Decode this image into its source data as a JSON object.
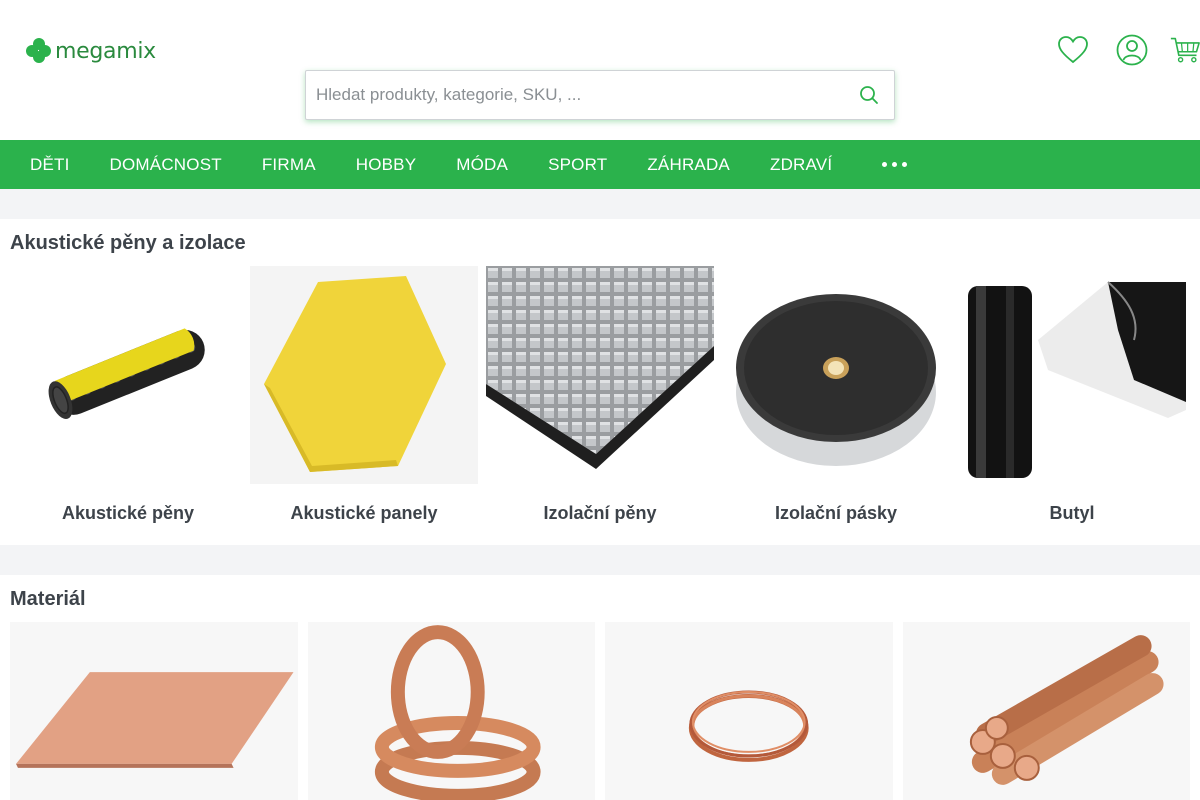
{
  "brand": {
    "name": "megamix",
    "color": "#2bb24c"
  },
  "search": {
    "placeholder": "Hledat produkty, kategorie, SKU, ..."
  },
  "header_icons": [
    "heart-icon",
    "user-icon",
    "cart-icon"
  ],
  "nav": {
    "items": [
      "DĚTI",
      "DOMÁCNOST",
      "FIRMA",
      "HOBBY",
      "MÓDA",
      "SPORT",
      "ZÁHRADA",
      "ZDRAVÍ"
    ],
    "more_icon": "more-dots-icon"
  },
  "sections": [
    {
      "title": "Akustické pěny a izolace",
      "categories": [
        {
          "label": "Akustické pěny"
        },
        {
          "label": "Akustické panely"
        },
        {
          "label": "Izolační pěny"
        },
        {
          "label": "Izolační pásky"
        },
        {
          "label": "Butyl"
        }
      ]
    },
    {
      "title": "Materiál",
      "items": [
        "copper-sheet",
        "copper-tape-rolls",
        "copper-wire-coil",
        "copper-rods"
      ]
    }
  ]
}
